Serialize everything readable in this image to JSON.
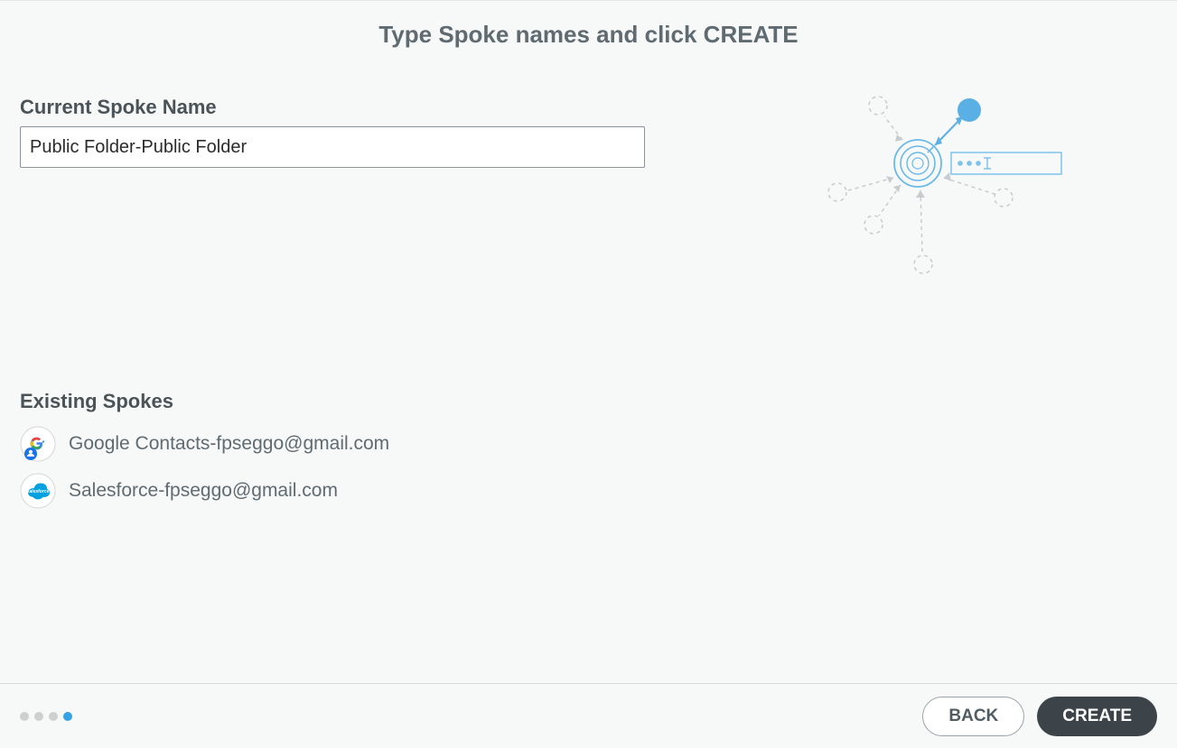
{
  "header": {
    "title": "Type Spoke names and click CREATE"
  },
  "form": {
    "field_label": "Current Spoke Name",
    "field_value": "Public Folder-Public Folder"
  },
  "existing": {
    "title": "Existing Spokes",
    "items": [
      {
        "icon": "google-contacts",
        "label": "Google Contacts-fpseggo@gmail.com"
      },
      {
        "icon": "salesforce",
        "label": "Salesforce-fpseggo@gmail.com"
      }
    ]
  },
  "stepper": {
    "total": 4,
    "active": 4
  },
  "footer": {
    "back_label": "BACK",
    "create_label": "CREATE"
  },
  "colors": {
    "accent": "#34a2e3",
    "text_secondary": "#5f6b71",
    "button_dark": "#3d4449"
  }
}
